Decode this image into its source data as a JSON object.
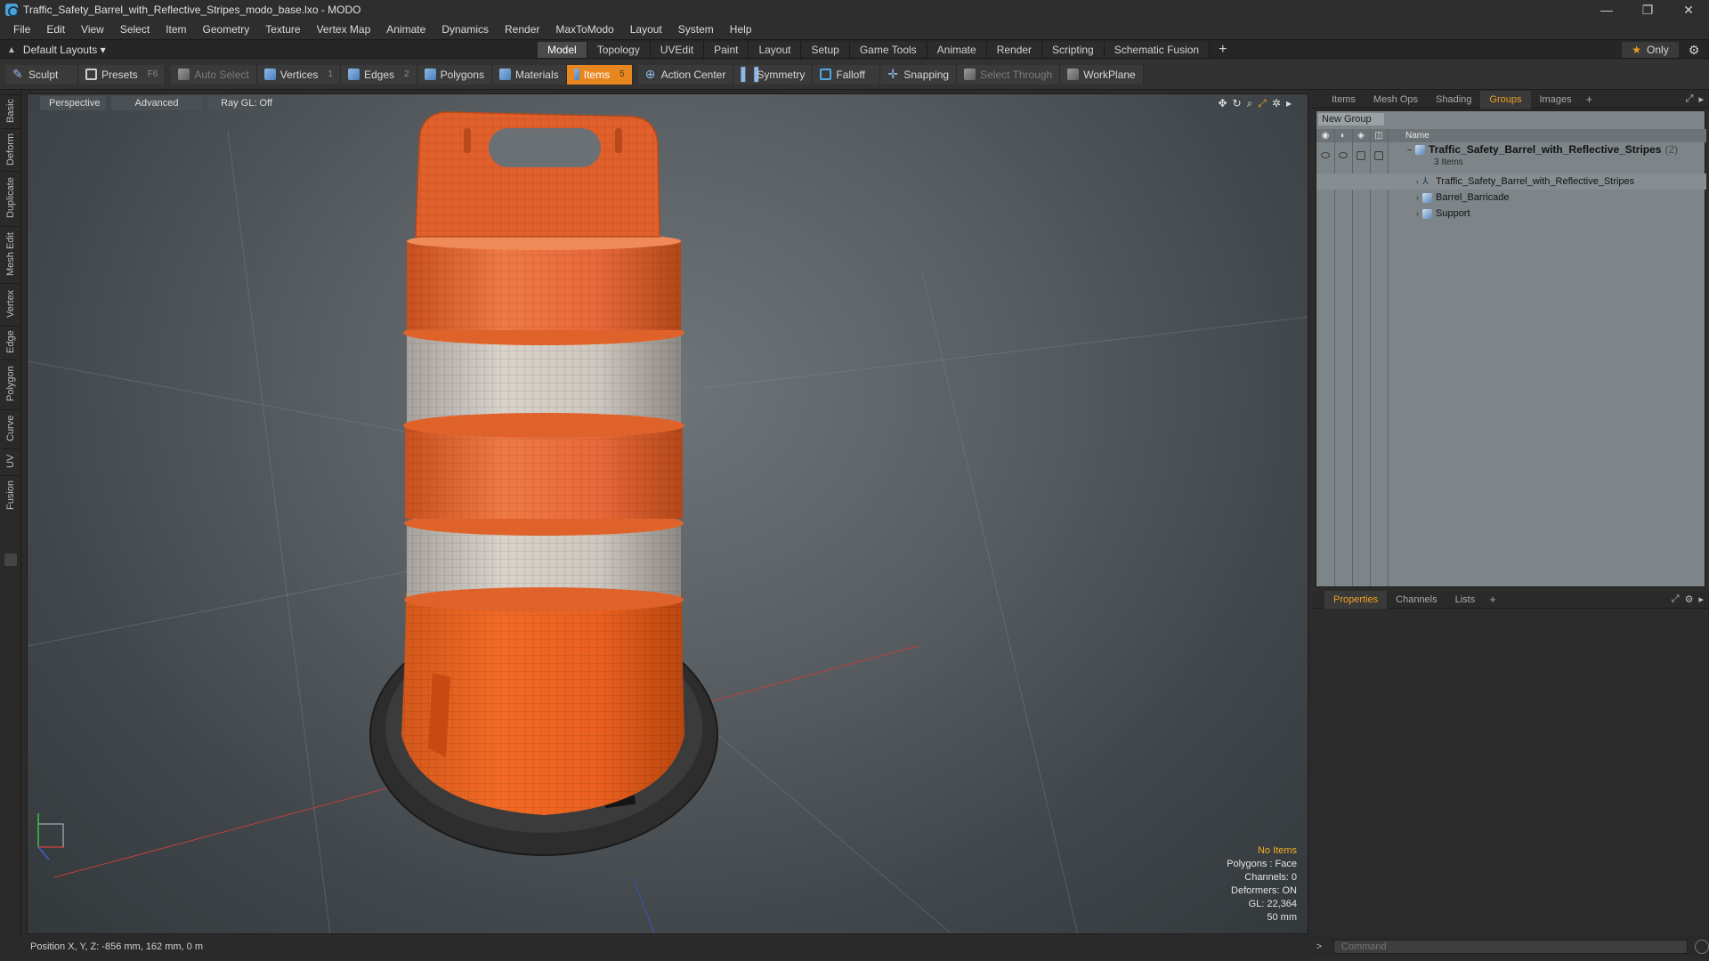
{
  "window": {
    "title": "Traffic_Safety_Barrel_with_Reflective_Stripes_modo_base.lxo - MODO",
    "controls": [
      "—",
      "❐",
      "✕"
    ]
  },
  "menu": [
    "File",
    "Edit",
    "View",
    "Select",
    "Item",
    "Geometry",
    "Texture",
    "Vertex Map",
    "Animate",
    "Dynamics",
    "Render",
    "MaxToModo",
    "Layout",
    "System",
    "Help"
  ],
  "layout_bar": {
    "layout_name": "Default Layouts ▾",
    "tabs": [
      "Model",
      "Topology",
      "UVEdit",
      "Paint",
      "Layout",
      "Setup",
      "Game Tools",
      "Animate",
      "Render",
      "Scripting",
      "Schematic Fusion"
    ],
    "active_tab": "Model",
    "add": "+",
    "only_label": "Only"
  },
  "toolbar": {
    "sculpt": "Sculpt",
    "presets": "Presets",
    "presets_key": "F6",
    "auto_select": "Auto Select",
    "vertices": "Vertices",
    "vertices_key": "1",
    "edges": "Edges",
    "edges_key": "2",
    "polygons": "Polygons",
    "materials": "Materials",
    "items": "Items",
    "items_key": "5",
    "action_center": "Action Center",
    "symmetry": "Symmetry",
    "falloff": "Falloff",
    "snapping": "Snapping",
    "select_through": "Select Through",
    "workplane": "WorkPlane"
  },
  "left_tabs": [
    "Basic",
    "Deform",
    "Duplicate",
    "Mesh Edit",
    "Vertex",
    "Edge",
    "Polygon",
    "Curve",
    "UV",
    "Fusion"
  ],
  "viewport": {
    "view": "Perspective",
    "shading": "Advanced",
    "raygl": "Ray GL: Off",
    "info": {
      "items": "No Items",
      "polygons": "Polygons : Face",
      "channels": "Channels: 0",
      "deformers": "Deformers: ON",
      "gl": "GL: 22,364",
      "scale": "50 mm"
    }
  },
  "status": {
    "position": "Position X, Y, Z:  -856 mm, 162 mm, 0 m"
  },
  "right_top_tabs": [
    "Items",
    "Mesh Ops",
    "Shading",
    "Groups",
    "Images"
  ],
  "right_top_active": "Groups",
  "groups": {
    "new_group": "New Group",
    "column_name": "Name",
    "group_name": "Traffic_Safety_Barrel_with_Reflective_Stripes",
    "group_count": "(2)",
    "group_sub": "3 Items",
    "children": [
      "Traffic_Safety_Barrel_with_Reflective_Stripes",
      "Barrel_Barricade",
      "Support"
    ]
  },
  "right_bottom_tabs": [
    "Properties",
    "Channels",
    "Lists"
  ],
  "right_bottom_active": "Properties",
  "command": {
    "placeholder": "Command"
  },
  "colors": {
    "accent": "#e8861f",
    "barrel_orange": "#e9642a",
    "stripe_white": "#d8d1c9",
    "base_black": "#2b2b2b"
  }
}
